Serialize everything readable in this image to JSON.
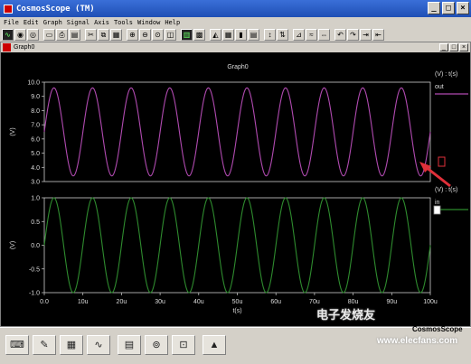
{
  "window": {
    "title": "CosmosScope (TM)",
    "controls": [
      "_",
      "□",
      "×"
    ]
  },
  "menu": [
    "File",
    "Edit",
    "Graph",
    "Signal",
    "Axis",
    "Tools",
    "Window",
    "Help"
  ],
  "graph_window": {
    "title": "Graph0",
    "controls": [
      "_",
      "□",
      "×"
    ]
  },
  "chart_data": [
    {
      "type": "line",
      "title": "Graph0",
      "xlabel": "t(s)",
      "ylabel": "(V)",
      "xlim": [
        0,
        100
      ],
      "x_unit": "u",
      "xticks": [
        "0.0",
        "10u",
        "20u",
        "30u",
        "40u",
        "50u",
        "60u",
        "70u",
        "80u",
        "90u",
        "100u"
      ],
      "ylim": [
        3.0,
        10.0
      ],
      "yticks": [
        "10.0",
        "9.0",
        "8.0",
        "7.0",
        "6.0",
        "5.0",
        "4.0",
        "3.0"
      ],
      "series": [
        {
          "name": "out",
          "color": "#b04ab0",
          "offset": 6.5,
          "amplitude": 3.1,
          "period": 10.0,
          "phase_deg": 0
        }
      ],
      "legend_header": "(V) : t(s)"
    },
    {
      "type": "line",
      "xlabel": "t(s)",
      "ylabel": "(V)",
      "xlim": [
        0,
        100
      ],
      "ylim": [
        -1.0,
        1.0
      ],
      "yticks": [
        "1.0",
        "0.5",
        "0.0",
        "-0.5",
        "-1.0"
      ],
      "series": [
        {
          "name": "in",
          "color": "#2e8b2e",
          "offset": 0.0,
          "amplitude": 1.0,
          "period": 10.0,
          "phase_deg": 0
        }
      ],
      "legend_header": "(V) : t(s)"
    }
  ],
  "annotation": {
    "color": "#e0303a"
  },
  "brand_label": "CosmosScope",
  "watermark": {
    "line1": "电子发烧友",
    "line2": "www.elecfans.com"
  },
  "toolbar_icons": [
    "scope-icon",
    "waveform-icon",
    "disk-icon",
    "open-icon",
    "print-icon",
    "cut-icon",
    "copy-icon",
    "paste-icon",
    "zoom-in-icon",
    "zoom-out-icon",
    "zoom-fit-icon",
    "zoom-area-icon",
    "stack-icon",
    "color-icon",
    "grid-icon",
    "measure-icon",
    "bars-icon",
    "marker-icon",
    "cursor-icon",
    "delta-icon",
    "split-icon",
    "undo-icon"
  ],
  "bottom_icons": [
    "keyboard-icon",
    "pen-icon",
    "calculator-graph-icon",
    "wave-tool-icon",
    "calculator-icon",
    "reel-icon",
    "network-icon",
    "matlab-icon"
  ]
}
